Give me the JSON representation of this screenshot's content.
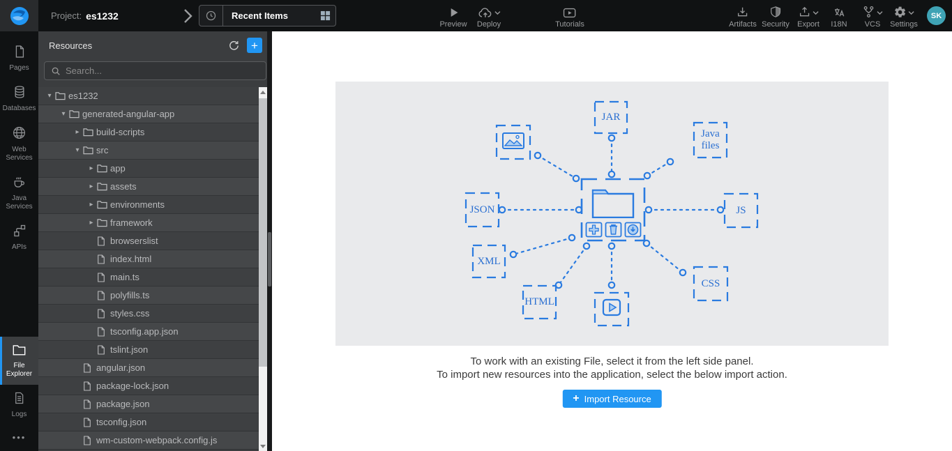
{
  "header": {
    "project_label": "Project:",
    "project_name": "es1232",
    "recent_items": {
      "label": "Recent Items"
    },
    "actions_center": [
      {
        "id": "preview",
        "icon": "play",
        "label": "Preview"
      },
      {
        "id": "deploy",
        "icon": "cloud-upload",
        "label": "Deploy",
        "caret": true
      },
      {
        "id": "tutorials",
        "icon": "video-tutorials",
        "label": "Tutorials"
      }
    ],
    "actions_right": [
      {
        "id": "artifacts",
        "icon": "download-tray",
        "label": "Artifacts"
      },
      {
        "id": "security",
        "icon": "shield",
        "label": "Security"
      },
      {
        "id": "export",
        "icon": "upload-tray",
        "label": "Export",
        "caret": true
      },
      {
        "id": "i18n",
        "icon": "translate",
        "label": "I18N"
      },
      {
        "id": "vcs",
        "icon": "branch",
        "label": "VCS",
        "caret": true
      },
      {
        "id": "settings",
        "icon": "gear",
        "label": "Settings",
        "caret": true
      }
    ],
    "avatar_initials": "SK"
  },
  "sidebar": {
    "items": [
      {
        "id": "pages",
        "icon": "pages",
        "label": "Pages"
      },
      {
        "id": "databases",
        "icon": "database",
        "label": "Databases"
      },
      {
        "id": "web-services",
        "icon": "globe",
        "label": "Web Services"
      },
      {
        "id": "java-services",
        "icon": "coffee",
        "label": "Java Services"
      },
      {
        "id": "apis",
        "icon": "api-nodes",
        "label": "APIs"
      }
    ],
    "bottom_items": [
      {
        "id": "file-explorer",
        "icon": "folder",
        "label": "File Explorer",
        "active": true
      },
      {
        "id": "logs",
        "icon": "log-document",
        "label": "Logs"
      }
    ],
    "overflow_label": "•••"
  },
  "resources_panel": {
    "title": "Resources",
    "search_placeholder": "Search...",
    "tree": [
      {
        "label": "es1232",
        "depth": 0,
        "kind": "folder",
        "state": "expanded"
      },
      {
        "label": "generated-angular-app",
        "depth": 1,
        "kind": "folder",
        "state": "expanded"
      },
      {
        "label": "build-scripts",
        "depth": 2,
        "kind": "folder",
        "state": "collapsed"
      },
      {
        "label": "src",
        "depth": 2,
        "kind": "folder",
        "state": "expanded"
      },
      {
        "label": "app",
        "depth": 3,
        "kind": "folder",
        "state": "collapsed"
      },
      {
        "label": "assets",
        "depth": 3,
        "kind": "folder",
        "state": "collapsed"
      },
      {
        "label": "environments",
        "depth": 3,
        "kind": "folder",
        "state": "collapsed"
      },
      {
        "label": "framework",
        "depth": 3,
        "kind": "folder",
        "state": "collapsed"
      },
      {
        "label": "browserslist",
        "depth": 3,
        "kind": "file"
      },
      {
        "label": "index.html",
        "depth": 3,
        "kind": "file"
      },
      {
        "label": "main.ts",
        "depth": 3,
        "kind": "file"
      },
      {
        "label": "polyfills.ts",
        "depth": 3,
        "kind": "file"
      },
      {
        "label": "styles.css",
        "depth": 3,
        "kind": "file"
      },
      {
        "label": "tsconfig.app.json",
        "depth": 3,
        "kind": "file"
      },
      {
        "label": "tslint.json",
        "depth": 3,
        "kind": "file"
      },
      {
        "label": "angular.json",
        "depth": 2,
        "kind": "file"
      },
      {
        "label": "package-lock.json",
        "depth": 2,
        "kind": "file"
      },
      {
        "label": "package.json",
        "depth": 2,
        "kind": "file"
      },
      {
        "label": "tsconfig.json",
        "depth": 2,
        "kind": "file"
      },
      {
        "label": "wm-custom-webpack.config.js",
        "depth": 2,
        "kind": "file"
      }
    ]
  },
  "main": {
    "diagram": {
      "nodes": [
        {
          "id": "image",
          "icon": "image-file"
        },
        {
          "id": "jar",
          "label": "JAR"
        },
        {
          "id": "java-files",
          "label": "Java files"
        },
        {
          "id": "json",
          "label": "JSON"
        },
        {
          "id": "js",
          "label": "JS"
        },
        {
          "id": "xml",
          "label": "XML"
        },
        {
          "id": "html",
          "label": "HTML"
        },
        {
          "id": "video",
          "icon": "video-file"
        },
        {
          "id": "css",
          "label": "CSS"
        },
        {
          "id": "center",
          "icon": "folder-actions"
        }
      ]
    },
    "instructions": [
      "To work with an existing File, select it from the left side panel.",
      "To import new resources into the application, select the below import action."
    ],
    "import_button_label": "Import Resource"
  },
  "colors": {
    "accent": "#2196f3",
    "diagram_blue": "#2a7be0",
    "diagram_fill": "#aecff2",
    "avatar_bg": "#3fa3b5",
    "header_bg": "#101213",
    "panel_bg": "#3b3d3f"
  }
}
